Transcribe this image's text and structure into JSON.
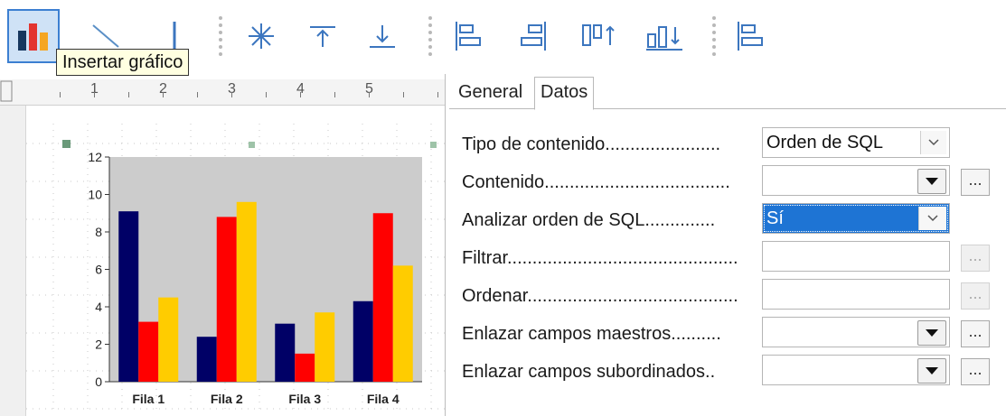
{
  "toolbar": {
    "tooltip": "Insertar gráfico",
    "buttons": [
      {
        "icon": "insert-chart-icon"
      },
      {
        "icon": "diagonal-line-icon"
      },
      {
        "icon": "vertical-line-icon"
      },
      {
        "icon": "asterisk-icon"
      },
      {
        "icon": "align-top-icon"
      },
      {
        "icon": "align-bottom-icon"
      },
      {
        "icon": "align-left-icon"
      },
      {
        "icon": "align-right-icon"
      },
      {
        "icon": "align-to-top-icon"
      },
      {
        "icon": "align-to-bottom-icon"
      },
      {
        "icon": "align-left-2-icon"
      }
    ]
  },
  "ruler": {
    "labels": [
      "1",
      "2",
      "3",
      "4",
      "5"
    ]
  },
  "chart_data": {
    "type": "bar",
    "categories": [
      "Fila 1",
      "Fila 2",
      "Fila 3",
      "Fila 4"
    ],
    "series": [
      {
        "values": [
          9.1,
          2.4,
          3.1,
          4.3
        ],
        "color": "#000066"
      },
      {
        "values": [
          3.2,
          8.8,
          1.5,
          9.0
        ],
        "color": "#ff0000"
      },
      {
        "values": [
          4.5,
          9.6,
          3.7,
          6.2
        ],
        "color": "#ffcc00"
      }
    ],
    "ylim": [
      0,
      12
    ],
    "yticks": [
      0,
      2,
      4,
      6,
      8,
      10,
      12
    ],
    "plot_background": "#cccccc",
    "grid": false
  },
  "panel": {
    "tabs": [
      "General",
      "Datos"
    ],
    "active_tab": "Datos",
    "rows": [
      {
        "label": "Tipo de contenido.......................",
        "value": "Orden de SQL",
        "control": "dropdown",
        "ellipsis": false
      },
      {
        "label": "Contenido.....................................",
        "value": "",
        "control": "combo",
        "ellipsis": true,
        "ellipsis_enabled": true,
        "ellipsis_label": "..."
      },
      {
        "label": "Analizar orden de SQL..............",
        "value": "Sí",
        "control": "dropdown-selected",
        "ellipsis": false
      },
      {
        "label": "Filtrar..............................................",
        "value": "",
        "control": "text",
        "ellipsis": true,
        "ellipsis_enabled": false,
        "ellipsis_label": "..."
      },
      {
        "label": "Ordenar..........................................",
        "value": "",
        "control": "text",
        "ellipsis": true,
        "ellipsis_enabled": false,
        "ellipsis_label": "..."
      },
      {
        "label": "Enlazar campos maestros..........",
        "value": "",
        "control": "combo",
        "ellipsis": true,
        "ellipsis_enabled": true,
        "ellipsis_label": "..."
      },
      {
        "label": "Enlazar campos subordinados..",
        "value": "",
        "control": "combo",
        "ellipsis": true,
        "ellipsis_enabled": true,
        "ellipsis_label": "..."
      }
    ]
  },
  "colors": {
    "selection": "#1e74d4",
    "active_button_border": "#3c7fd1",
    "tooltip_bg": "#ffffe1"
  }
}
